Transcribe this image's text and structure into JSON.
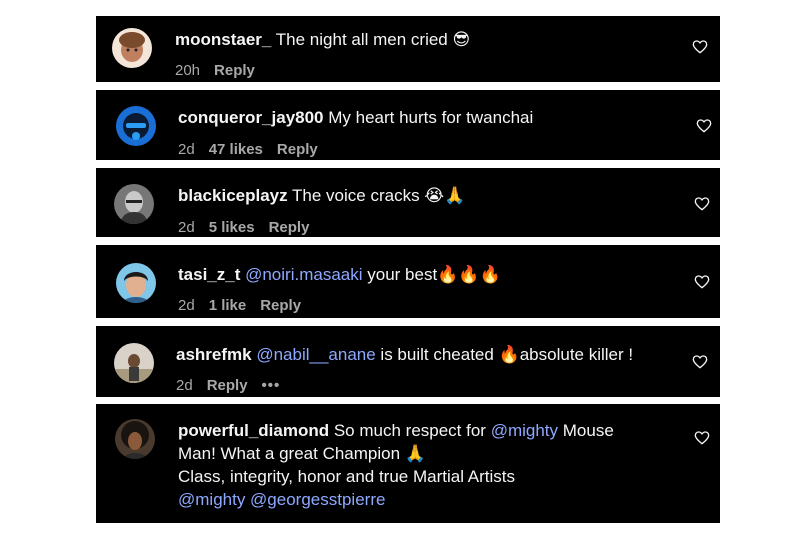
{
  "comments": [
    {
      "username": "moonstaer_",
      "text": " The night all men cried 😎",
      "time": "20h",
      "likes": "",
      "reply": "Reply"
    },
    {
      "username": "conqueror_jay800",
      "text": " My heart hurts for twanchai",
      "time": "2d",
      "likes": "47 likes",
      "reply": "Reply"
    },
    {
      "username": "blackiceplayz",
      "text": " The voice cracks 😭🙏",
      "time": "2d",
      "likes": "5 likes",
      "reply": "Reply"
    },
    {
      "username": "tasi_z_t",
      "mention": " @noiri.masaaki",
      "text": " your best🔥🔥🔥",
      "time": "2d",
      "likes": "1 like",
      "reply": "Reply"
    },
    {
      "username": "ashrefmk",
      "mention": " @nabil__anane",
      "text": " is built cheated 🔥absolute killer !",
      "time": "2d",
      "reply": "Reply",
      "more": "•••"
    },
    {
      "username": "powerful_diamond",
      "text_a": " So much respect for ",
      "mention_a": "@mighty",
      "text_b": " Mouse",
      "line2": "Man! What a great Champion 🙏",
      "line3": "Class, integrity, honor and true Martial Artists",
      "mention_b": "@mighty",
      "mention_c": " @georgesstpierre"
    }
  ],
  "colors": {
    "background": "#000000",
    "text": "#f5f5f5",
    "meta": "#a8a8a8",
    "mention": "#8ea8ff"
  },
  "icons": {
    "like": "heart-outline-icon",
    "more": "more-options-icon"
  }
}
